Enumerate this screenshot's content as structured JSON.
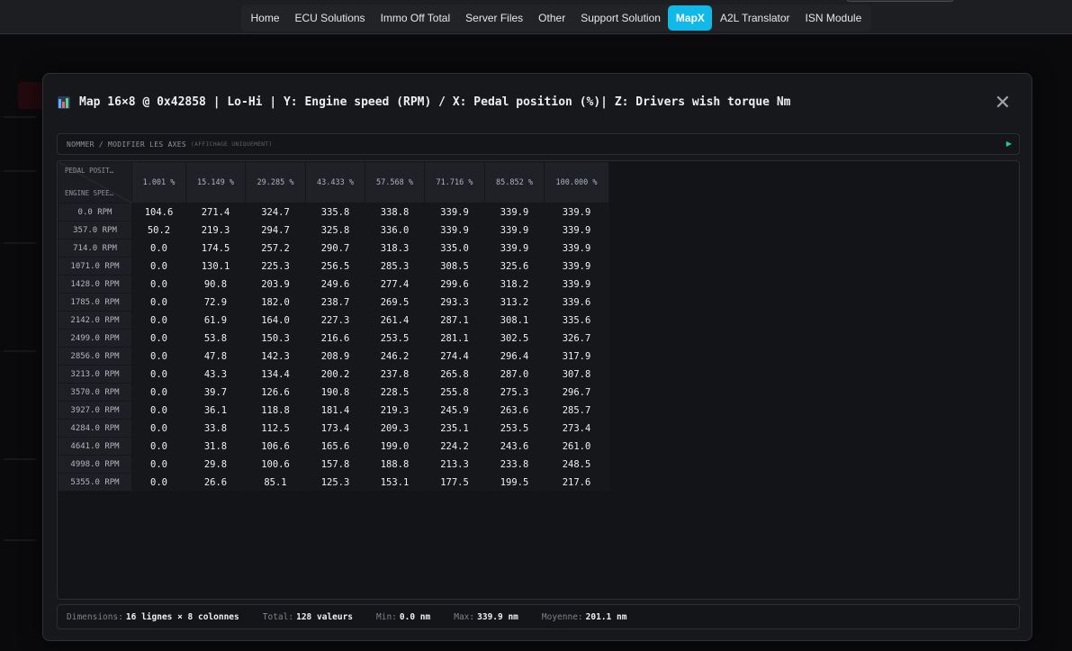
{
  "nav": {
    "items": [
      {
        "label": "Home",
        "active": false
      },
      {
        "label": "ECU Solutions",
        "active": false
      },
      {
        "label": "Immo Off Total",
        "active": false
      },
      {
        "label": "Server Files",
        "active": false
      },
      {
        "label": "Other",
        "active": false
      },
      {
        "label": "Support Solution",
        "active": false
      },
      {
        "label": "MapX",
        "active": true
      },
      {
        "label": "A2L Translator",
        "active": false
      },
      {
        "label": "ISN Module",
        "active": false
      }
    ],
    "accent_color": "#10b9e8"
  },
  "modal": {
    "icon": "bar-chart-icon",
    "title": "Map 16×8 @ 0x42858 | Lo-Hi | Y: Engine speed (RPM) / X: Pedal position (%)| Z: Drivers wish torque Nm",
    "close_symbol": "✕",
    "axes_bar": {
      "label": "NOMMER / MODIFIER LES AXES",
      "sub_label": "(AFFICHAGE UNIQUEMENT)",
      "arrow": "▶"
    },
    "table": {
      "corner_x_label": "PEDAL POSIT…",
      "corner_y_label": "ENGINE SPEE…",
      "columns": [
        "1.001 %",
        "15.149 %",
        "29.285 %",
        "43.433 %",
        "57.568 %",
        "71.716 %",
        "85.852 %",
        "100.000 %"
      ],
      "rows": [
        {
          "label": "0.0 RPM",
          "values": [
            "104.6",
            "271.4",
            "324.7",
            "335.8",
            "338.8",
            "339.9",
            "339.9",
            "339.9"
          ]
        },
        {
          "label": "357.0 RPM",
          "values": [
            "50.2",
            "219.3",
            "294.7",
            "325.8",
            "336.0",
            "339.9",
            "339.9",
            "339.9"
          ]
        },
        {
          "label": "714.0 RPM",
          "values": [
            "0.0",
            "174.5",
            "257.2",
            "290.7",
            "318.3",
            "335.0",
            "339.9",
            "339.9"
          ]
        },
        {
          "label": "1071.0 RPM",
          "values": [
            "0.0",
            "130.1",
            "225.3",
            "256.5",
            "285.3",
            "308.5",
            "325.6",
            "339.9"
          ]
        },
        {
          "label": "1428.0 RPM",
          "values": [
            "0.0",
            "90.8",
            "203.9",
            "249.6",
            "277.4",
            "299.6",
            "318.2",
            "339.9"
          ]
        },
        {
          "label": "1785.0 RPM",
          "values": [
            "0.0",
            "72.9",
            "182.0",
            "238.7",
            "269.5",
            "293.3",
            "313.2",
            "339.6"
          ]
        },
        {
          "label": "2142.0 RPM",
          "values": [
            "0.0",
            "61.9",
            "164.0",
            "227.3",
            "261.4",
            "287.1",
            "308.1",
            "335.6"
          ]
        },
        {
          "label": "2499.0 RPM",
          "values": [
            "0.0",
            "53.8",
            "150.3",
            "216.6",
            "253.5",
            "281.1",
            "302.5",
            "326.7"
          ]
        },
        {
          "label": "2856.0 RPM",
          "values": [
            "0.0",
            "47.8",
            "142.3",
            "208.9",
            "246.2",
            "274.4",
            "296.4",
            "317.9"
          ]
        },
        {
          "label": "3213.0 RPM",
          "values": [
            "0.0",
            "43.3",
            "134.4",
            "200.2",
            "237.8",
            "265.8",
            "287.0",
            "307.8"
          ]
        },
        {
          "label": "3570.0 RPM",
          "values": [
            "0.0",
            "39.7",
            "126.6",
            "190.8",
            "228.5",
            "255.8",
            "275.3",
            "296.7"
          ]
        },
        {
          "label": "3927.0 RPM",
          "values": [
            "0.0",
            "36.1",
            "118.8",
            "181.4",
            "219.3",
            "245.9",
            "263.6",
            "285.7"
          ]
        },
        {
          "label": "4284.0 RPM",
          "values": [
            "0.0",
            "33.8",
            "112.5",
            "173.4",
            "209.3",
            "235.1",
            "253.5",
            "273.4"
          ]
        },
        {
          "label": "4641.0 RPM",
          "values": [
            "0.0",
            "31.8",
            "106.6",
            "165.6",
            "199.0",
            "224.2",
            "243.6",
            "261.0"
          ]
        },
        {
          "label": "4998.0 RPM",
          "values": [
            "0.0",
            "29.8",
            "100.6",
            "157.8",
            "188.8",
            "213.3",
            "233.8",
            "248.5"
          ]
        },
        {
          "label": "5355.0 RPM",
          "values": [
            "0.0",
            "26.6",
            "85.1",
            "125.3",
            "153.1",
            "177.5",
            "199.5",
            "217.6"
          ]
        }
      ]
    },
    "footer": {
      "dimensions_label": "Dimensions:",
      "dimensions_value": "16 lignes × 8 colonnes",
      "total_label": "Total:",
      "total_value": "128 valeurs",
      "min_label": "Min:",
      "min_value": "0.0 nm",
      "max_label": "Max:",
      "max_value": "339.9 nm",
      "mean_label": "Moyenne:",
      "mean_value": "201.1 nm"
    }
  }
}
